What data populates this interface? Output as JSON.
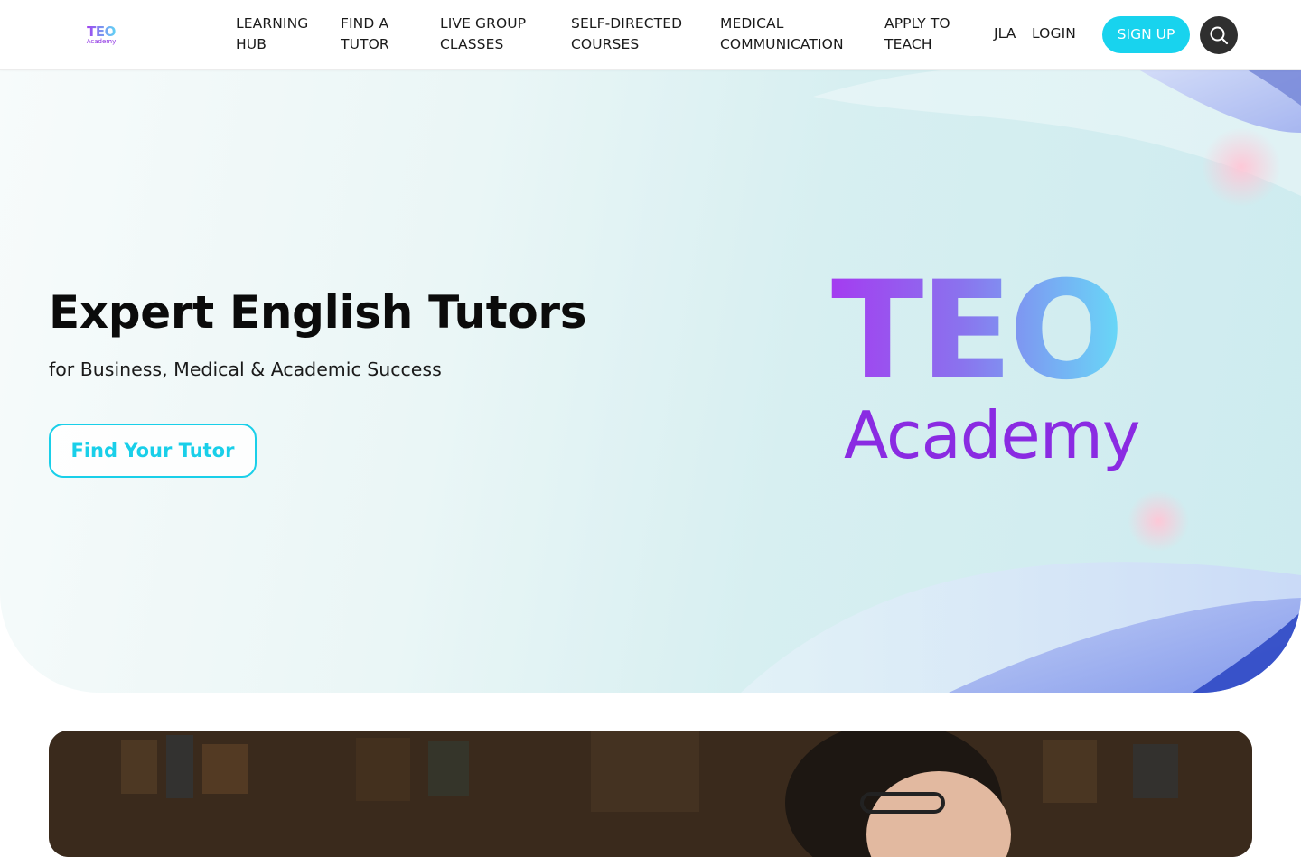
{
  "brand": {
    "logo_top": "TEO",
    "logo_bottom": "Academy"
  },
  "nav": {
    "items": [
      {
        "line1": "LEARNING",
        "line2": "HUB"
      },
      {
        "line1": "FIND A",
        "line2": "TUTOR"
      },
      {
        "line1": "LIVE GROUP",
        "line2": "CLASSES"
      },
      {
        "line1": "SELF-DIRECTED",
        "line2": "COURSES"
      },
      {
        "line1": "MEDICAL",
        "line2": "COMMUNICATION"
      },
      {
        "line1": "APPLY TO",
        "line2": "TEACH"
      }
    ],
    "jla": "JLA",
    "login": "LOGIN",
    "signup": "SIGN UP",
    "search_icon": "search-icon"
  },
  "hero": {
    "title": "Expert English Tutors",
    "subtitle": "for Business, Medical & Academic Success",
    "cta": "Find Your Tutor",
    "logo_top": "TEO",
    "logo_bottom": "Academy"
  },
  "colors": {
    "accent": "#18d3ee",
    "brand_purple": "#8a2be2",
    "dark": "#2f2f2f"
  }
}
